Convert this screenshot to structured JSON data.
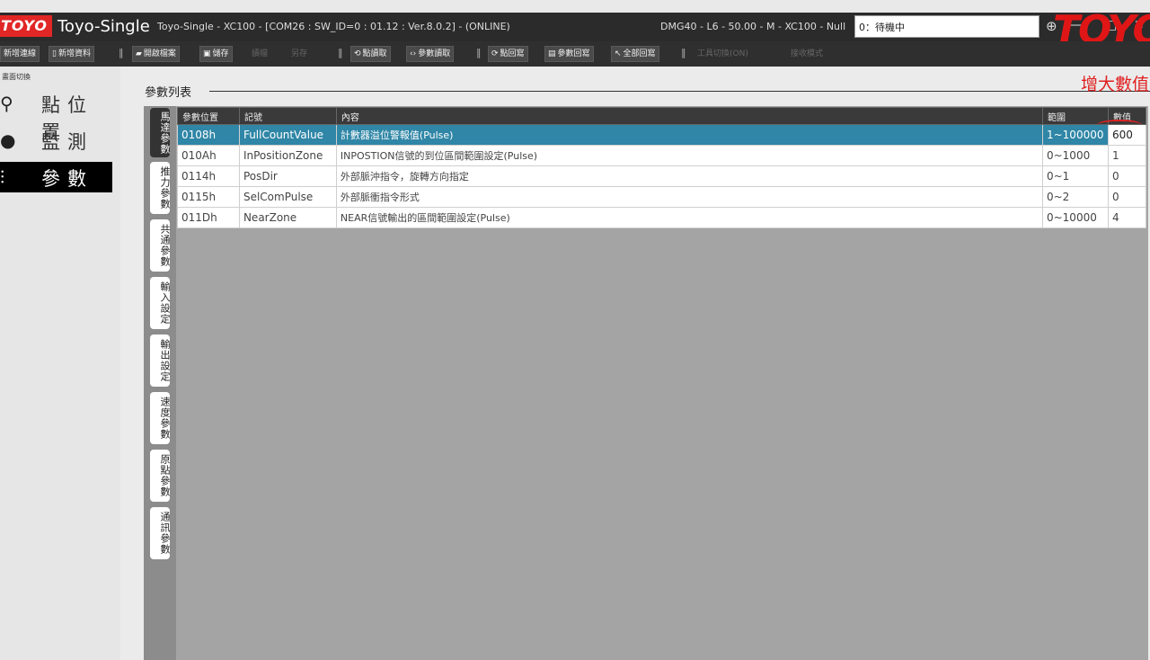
{
  "titlebar": {
    "logo": "TOYO",
    "app_title": "Toyo-Single",
    "connection": "Toyo-Single - XC100 - [COM26 : SW_ID=0 : 01.12 : Ver.8.0.2] - (ONLINE)",
    "model": "DMG40 - L6 - 50.00 - M - XC100 - Null",
    "status_value": "0：待機中",
    "brand": "TOYO"
  },
  "toolbar": {
    "new_connection": "新增連線",
    "new_data": "新增資料",
    "open_file": "開啟檔案",
    "save": "儲存",
    "disabled1": "讀檔",
    "disabled2": "另存",
    "point_read": "點讀取",
    "param_read": "參數讀取",
    "point_write": "點回寫",
    "param_write": "參數回寫",
    "write_all": "全部回寫",
    "disabled3": "工具切換(ON)",
    "disabled4": "接收模式"
  },
  "leftnav": {
    "caption": "畫面切換",
    "items": [
      {
        "label": "點位置",
        "icon": "map-pin-icon"
      },
      {
        "label": "監測",
        "icon": "monitor-icon"
      },
      {
        "label": "參數",
        "icon": "sliders-icon"
      }
    ]
  },
  "main": {
    "section_title": "參數列表",
    "annotation": "增大數值"
  },
  "tabs": [
    {
      "label": "馬達參數"
    },
    {
      "label": "推力參數"
    },
    {
      "label": "共通參數"
    },
    {
      "label": "輸入設定"
    },
    {
      "label": "輸出設定"
    },
    {
      "label": "速度參數"
    },
    {
      "label": "原點參數"
    },
    {
      "label": "通訊參數"
    }
  ],
  "table": {
    "headers": [
      "參數位置",
      "記號",
      "內容",
      "範圍",
      "數值"
    ],
    "rows": [
      {
        "address": "0108h",
        "symbol": "FullCountValue",
        "content": "計數器溢位警報值(Pulse)",
        "range": "1~100000",
        "value": "600"
      },
      {
        "address": "010Ah",
        "symbol": "InPositionZone",
        "content": "INPOSTION信號的到位區間範圍設定(Pulse)",
        "range": "0~1000",
        "value": "1"
      },
      {
        "address": "0114h",
        "symbol": "PosDir",
        "content": "外部脈沖指令，旋轉方向指定",
        "range": "0~1",
        "value": "0"
      },
      {
        "address": "0115h",
        "symbol": "SelComPulse",
        "content": "外部脈衝指令形式",
        "range": "0~2",
        "value": "0"
      },
      {
        "address": "011Dh",
        "symbol": "NearZone",
        "content": "NEAR信號輸出的區間範圍設定(Pulse)",
        "range": "0~10000",
        "value": "4"
      }
    ]
  }
}
